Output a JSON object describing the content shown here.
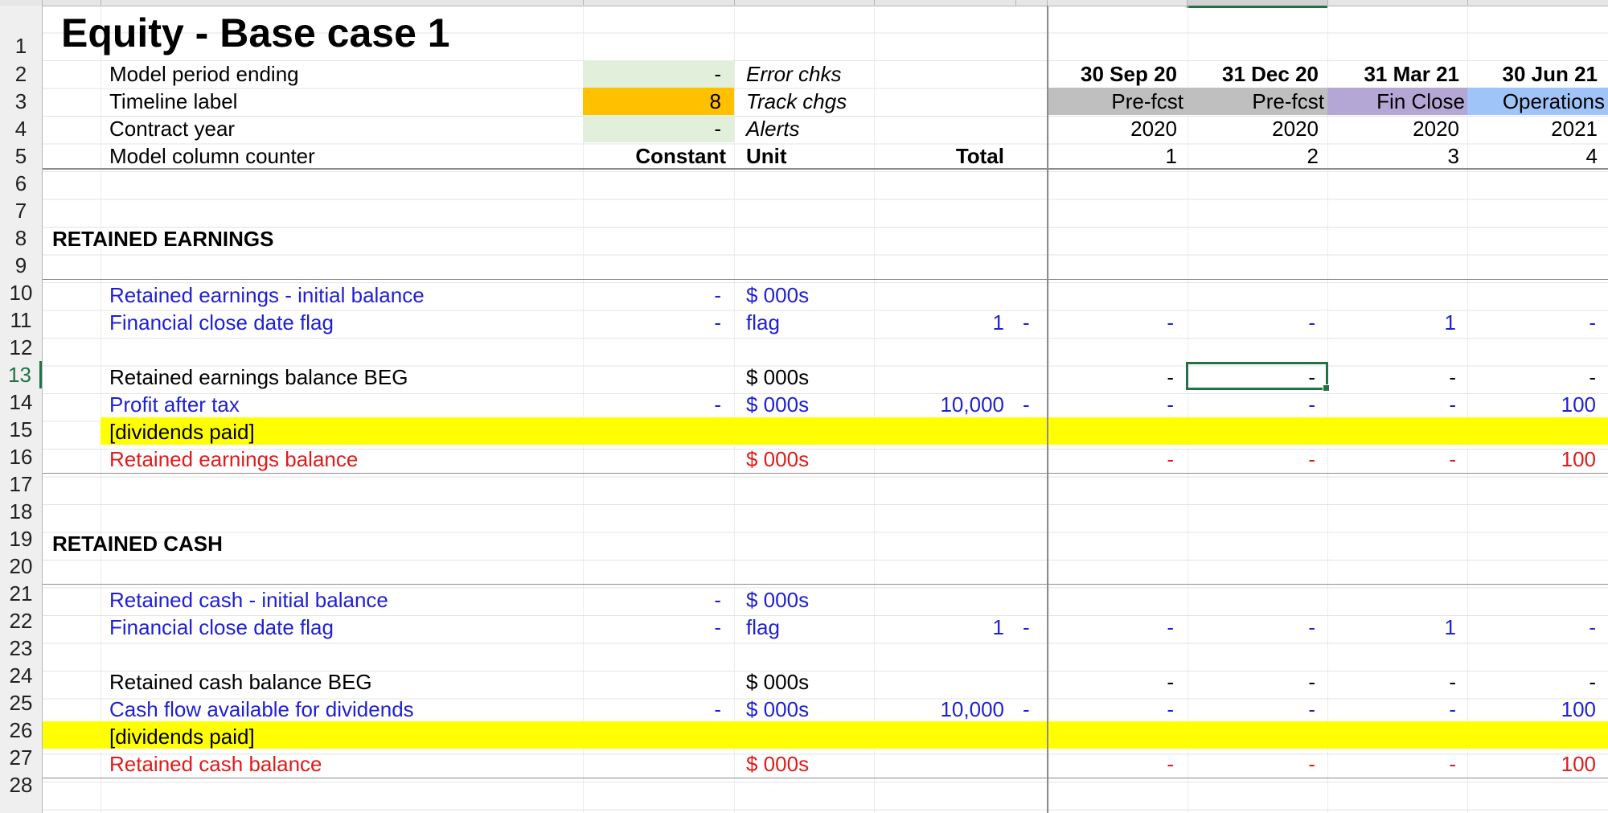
{
  "colors": {
    "input_green": "#e2efda",
    "timeline_orange": "#ffc000",
    "prefcst_grey": "#bfbfbf",
    "finclose_purple": "#b4a7d6",
    "operations_blue": "#9fc5f8",
    "highlight_yellow": "#ffff00",
    "input_blue": "#1f1fd6",
    "output_red": "#e01b1b",
    "selection_green": "#217346"
  },
  "rows": [
    "1",
    "2",
    "3",
    "4",
    "5",
    "6",
    "7",
    "8",
    "9",
    "10",
    "11",
    "12",
    "13",
    "14",
    "15",
    "16",
    "17",
    "18",
    "19",
    "20",
    "21",
    "22",
    "23",
    "24",
    "25",
    "26",
    "27",
    "28"
  ],
  "sheet": {
    "title": "Equity - Base case 1",
    "header": {
      "model_period_label": "Model period ending",
      "model_period_value": "-",
      "timeline_label": "Timeline label",
      "timeline_value": "8",
      "contract_year_label": "Contract year",
      "contract_year_value": "-",
      "counter_label": "Model column counter",
      "constant": "Constant",
      "unit": "Unit",
      "total": "Total",
      "error_chks": "Error chks",
      "track_chgs": "Track chgs",
      "alerts": "Alerts"
    },
    "periods": [
      {
        "date": "30 Sep 20",
        "phase": "Pre-fcst",
        "year": "2020",
        "counter": "1"
      },
      {
        "date": "31 Dec 20",
        "phase": "Pre-fcst",
        "year": "2020",
        "counter": "2"
      },
      {
        "date": "31 Mar 21",
        "phase": "Fin Close",
        "year": "2020",
        "counter": "3"
      },
      {
        "date": "30 Jun 21",
        "phase": "Operations",
        "year": "2021",
        "counter": "4"
      }
    ],
    "section1": {
      "heading": "RETAINED EARNINGS",
      "r10": {
        "label": "Retained earnings - initial balance",
        "const": "-",
        "unit": "$ 000s"
      },
      "r11": {
        "label": "Financial close date flag",
        "const": "-",
        "unit": "flag",
        "total": "1",
        "chk": "-",
        "vals": [
          "-",
          "-",
          "1",
          "-"
        ]
      },
      "r13": {
        "label": "Retained earnings balance BEG",
        "unit": "$ 000s",
        "vals": [
          "-",
          "-",
          "-",
          "-"
        ]
      },
      "r14": {
        "label": "Profit after tax",
        "const": "-",
        "unit": "$ 000s",
        "total": "10,000",
        "chk": "-",
        "vals": [
          "-",
          "-",
          "-",
          "100"
        ]
      },
      "r15": {
        "label": "[dividends paid]"
      },
      "r16": {
        "label": "Retained earnings balance",
        "unit": "$ 000s",
        "vals": [
          "-",
          "-",
          "-",
          "100"
        ]
      }
    },
    "section2": {
      "heading": "RETAINED CASH",
      "r21": {
        "label": "Retained cash - initial balance",
        "const": "-",
        "unit": "$ 000s"
      },
      "r22": {
        "label": "Financial close date flag",
        "const": "-",
        "unit": "flag",
        "total": "1",
        "chk": "-",
        "vals": [
          "-",
          "-",
          "1",
          "-"
        ]
      },
      "r24": {
        "label": "Retained cash balance BEG",
        "unit": "$ 000s",
        "vals": [
          "-",
          "-",
          "-",
          "-"
        ]
      },
      "r25": {
        "label": "Cash flow available for dividends",
        "const": "-",
        "unit": "$ 000s",
        "total": "10,000",
        "chk": "-",
        "vals": [
          "-",
          "-",
          "-",
          "100"
        ]
      },
      "r26": {
        "label": "[dividends paid]"
      },
      "r27": {
        "label": "Retained cash balance",
        "unit": "$ 000s",
        "vals": [
          "-",
          "-",
          "-",
          "100"
        ]
      }
    }
  }
}
